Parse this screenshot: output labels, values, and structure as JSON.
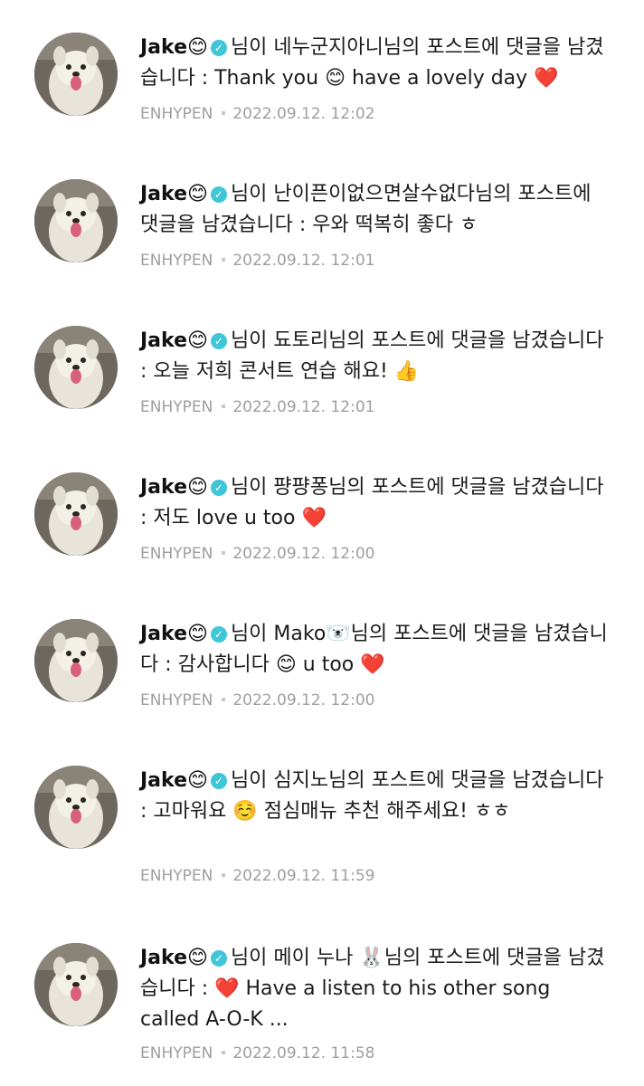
{
  "comments": [
    {
      "author": "Jake😊",
      "action_text": "님이 네누군지아니님의 포스트에 댓글을 남겼습니다 : Thank you 😊 have a lovely day ❤️",
      "source": "ENHYPEN",
      "timestamp": "2022.09.12. 12:02"
    },
    {
      "author": "Jake😊",
      "action_text": "님이 난이픈이없으면살수없다님의 포스트에 댓글을 남겼습니다 : 우와 떡복히 좋다 ㅎ",
      "source": "ENHYPEN",
      "timestamp": "2022.09.12. 12:01"
    },
    {
      "author": "Jake😊",
      "action_text": "님이 됴토리님의 포스트에 댓글을 남겼습니다 : 오늘 저희 콘서트 연습 해요! 👍",
      "source": "ENHYPEN",
      "timestamp": "2022.09.12. 12:01"
    },
    {
      "author": "Jake😊",
      "action_text": "님이 퍙퍙퐁님의 포스트에 댓글을 남겼습니다 : 저도 love u too ❤️",
      "source": "ENHYPEN",
      "timestamp": "2022.09.12. 12:00"
    },
    {
      "author": "Jake😊",
      "action_text": "님이 Mako🐻‍❄️님의 포스트에 댓글을 남겼습니다 : 감사합니다 😊 u too ❤️",
      "source": "ENHYPEN",
      "timestamp": "2022.09.12. 12:00"
    },
    {
      "author": "Jake😊",
      "action_text": "님이 심지노님의 포스트에 댓글을 남겼습니다 : 고마워요 ☺️ 점심매뉴 추천 해주세요! ㅎㅎ",
      "source": "ENHYPEN",
      "timestamp": "2022.09.12. 11:59"
    },
    {
      "author": "Jake😊",
      "action_text": "님이 메이 누나 🐰님의 포스트에 댓글을 남겼습니다 : ❤️ Have a listen to his other song called  A-O-K ...",
      "source": "ENHYPEN",
      "timestamp": "2022.09.12. 11:58"
    }
  ],
  "colors": {
    "verified_badge": "#3fc6d8",
    "meta_text": "#9e9e9e",
    "body_text": "#1b1b1b"
  },
  "icons": {
    "avatar": "dog-avatar-icon",
    "verified": "verified-badge-icon"
  }
}
